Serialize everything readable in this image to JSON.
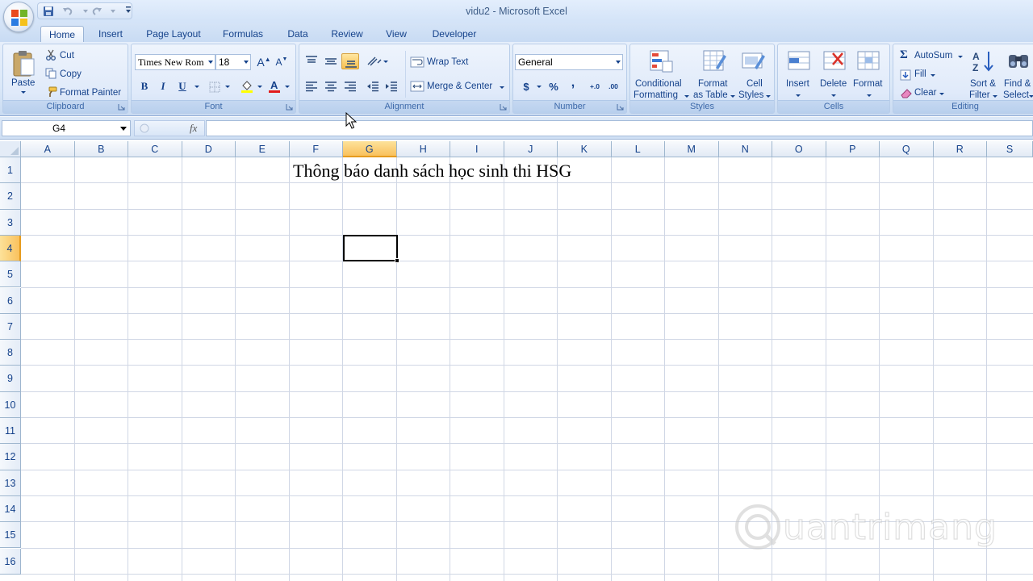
{
  "window": {
    "title": "vidu2 - Microsoft Excel"
  },
  "tabs": [
    {
      "label": "Home",
      "active": true
    },
    {
      "label": "Insert"
    },
    {
      "label": "Page Layout"
    },
    {
      "label": "Formulas"
    },
    {
      "label": "Data"
    },
    {
      "label": "Review"
    },
    {
      "label": "View"
    },
    {
      "label": "Developer"
    }
  ],
  "ribbon": {
    "clipboard": {
      "label": "Clipboard",
      "paste": "Paste",
      "cut": "Cut",
      "copy": "Copy",
      "format_painter": "Format Painter"
    },
    "font": {
      "label": "Font",
      "font_name": "Times New Rom",
      "font_size": "18",
      "bold": "B",
      "italic": "I",
      "underline": "U",
      "grow": "A",
      "shrink": "A"
    },
    "alignment": {
      "label": "Alignment",
      "wrap_text": "Wrap Text",
      "merge_center": "Merge & Center"
    },
    "number": {
      "label": "Number",
      "format": "General",
      "currency": "$",
      "percent": "%",
      "comma": ",",
      "inc_decimal": "+.0",
      "dec_decimal": ".00"
    },
    "styles": {
      "label": "Styles",
      "conditional_1": "Conditional",
      "conditional_2": "Formatting",
      "table_1": "Format",
      "table_2": "as Table",
      "cell_1": "Cell",
      "cell_2": "Styles"
    },
    "cells": {
      "label": "Cells",
      "insert": "Insert",
      "delete": "Delete",
      "format": "Format"
    },
    "editing": {
      "label": "Editing",
      "autosum": "AutoSum",
      "fill": "Fill",
      "clear": "Clear",
      "sort_1": "Sort &",
      "sort_2": "Filter",
      "find_1": "Find &",
      "find_2": "Select"
    }
  },
  "formula_bar": {
    "name_box": "G4",
    "fx": "fx",
    "value": ""
  },
  "sheet": {
    "columns": [
      "A",
      "B",
      "C",
      "D",
      "E",
      "F",
      "G",
      "H",
      "I",
      "J",
      "K",
      "L",
      "M",
      "N",
      "O",
      "P",
      "Q",
      "R",
      "S"
    ],
    "rows": [
      "1",
      "2",
      "3",
      "4",
      "5",
      "6",
      "7",
      "8",
      "9",
      "10",
      "11",
      "12",
      "13",
      "14",
      "15",
      "16"
    ],
    "selected_column": "G",
    "selected_row": "4",
    "cells": {
      "F1": "Thông báo danh sách học sinh thi HSG"
    }
  },
  "colors": {
    "accent": "#15428b",
    "selected_header": "#f9c15d",
    "ribbon_bg": "#dbe8f8"
  }
}
